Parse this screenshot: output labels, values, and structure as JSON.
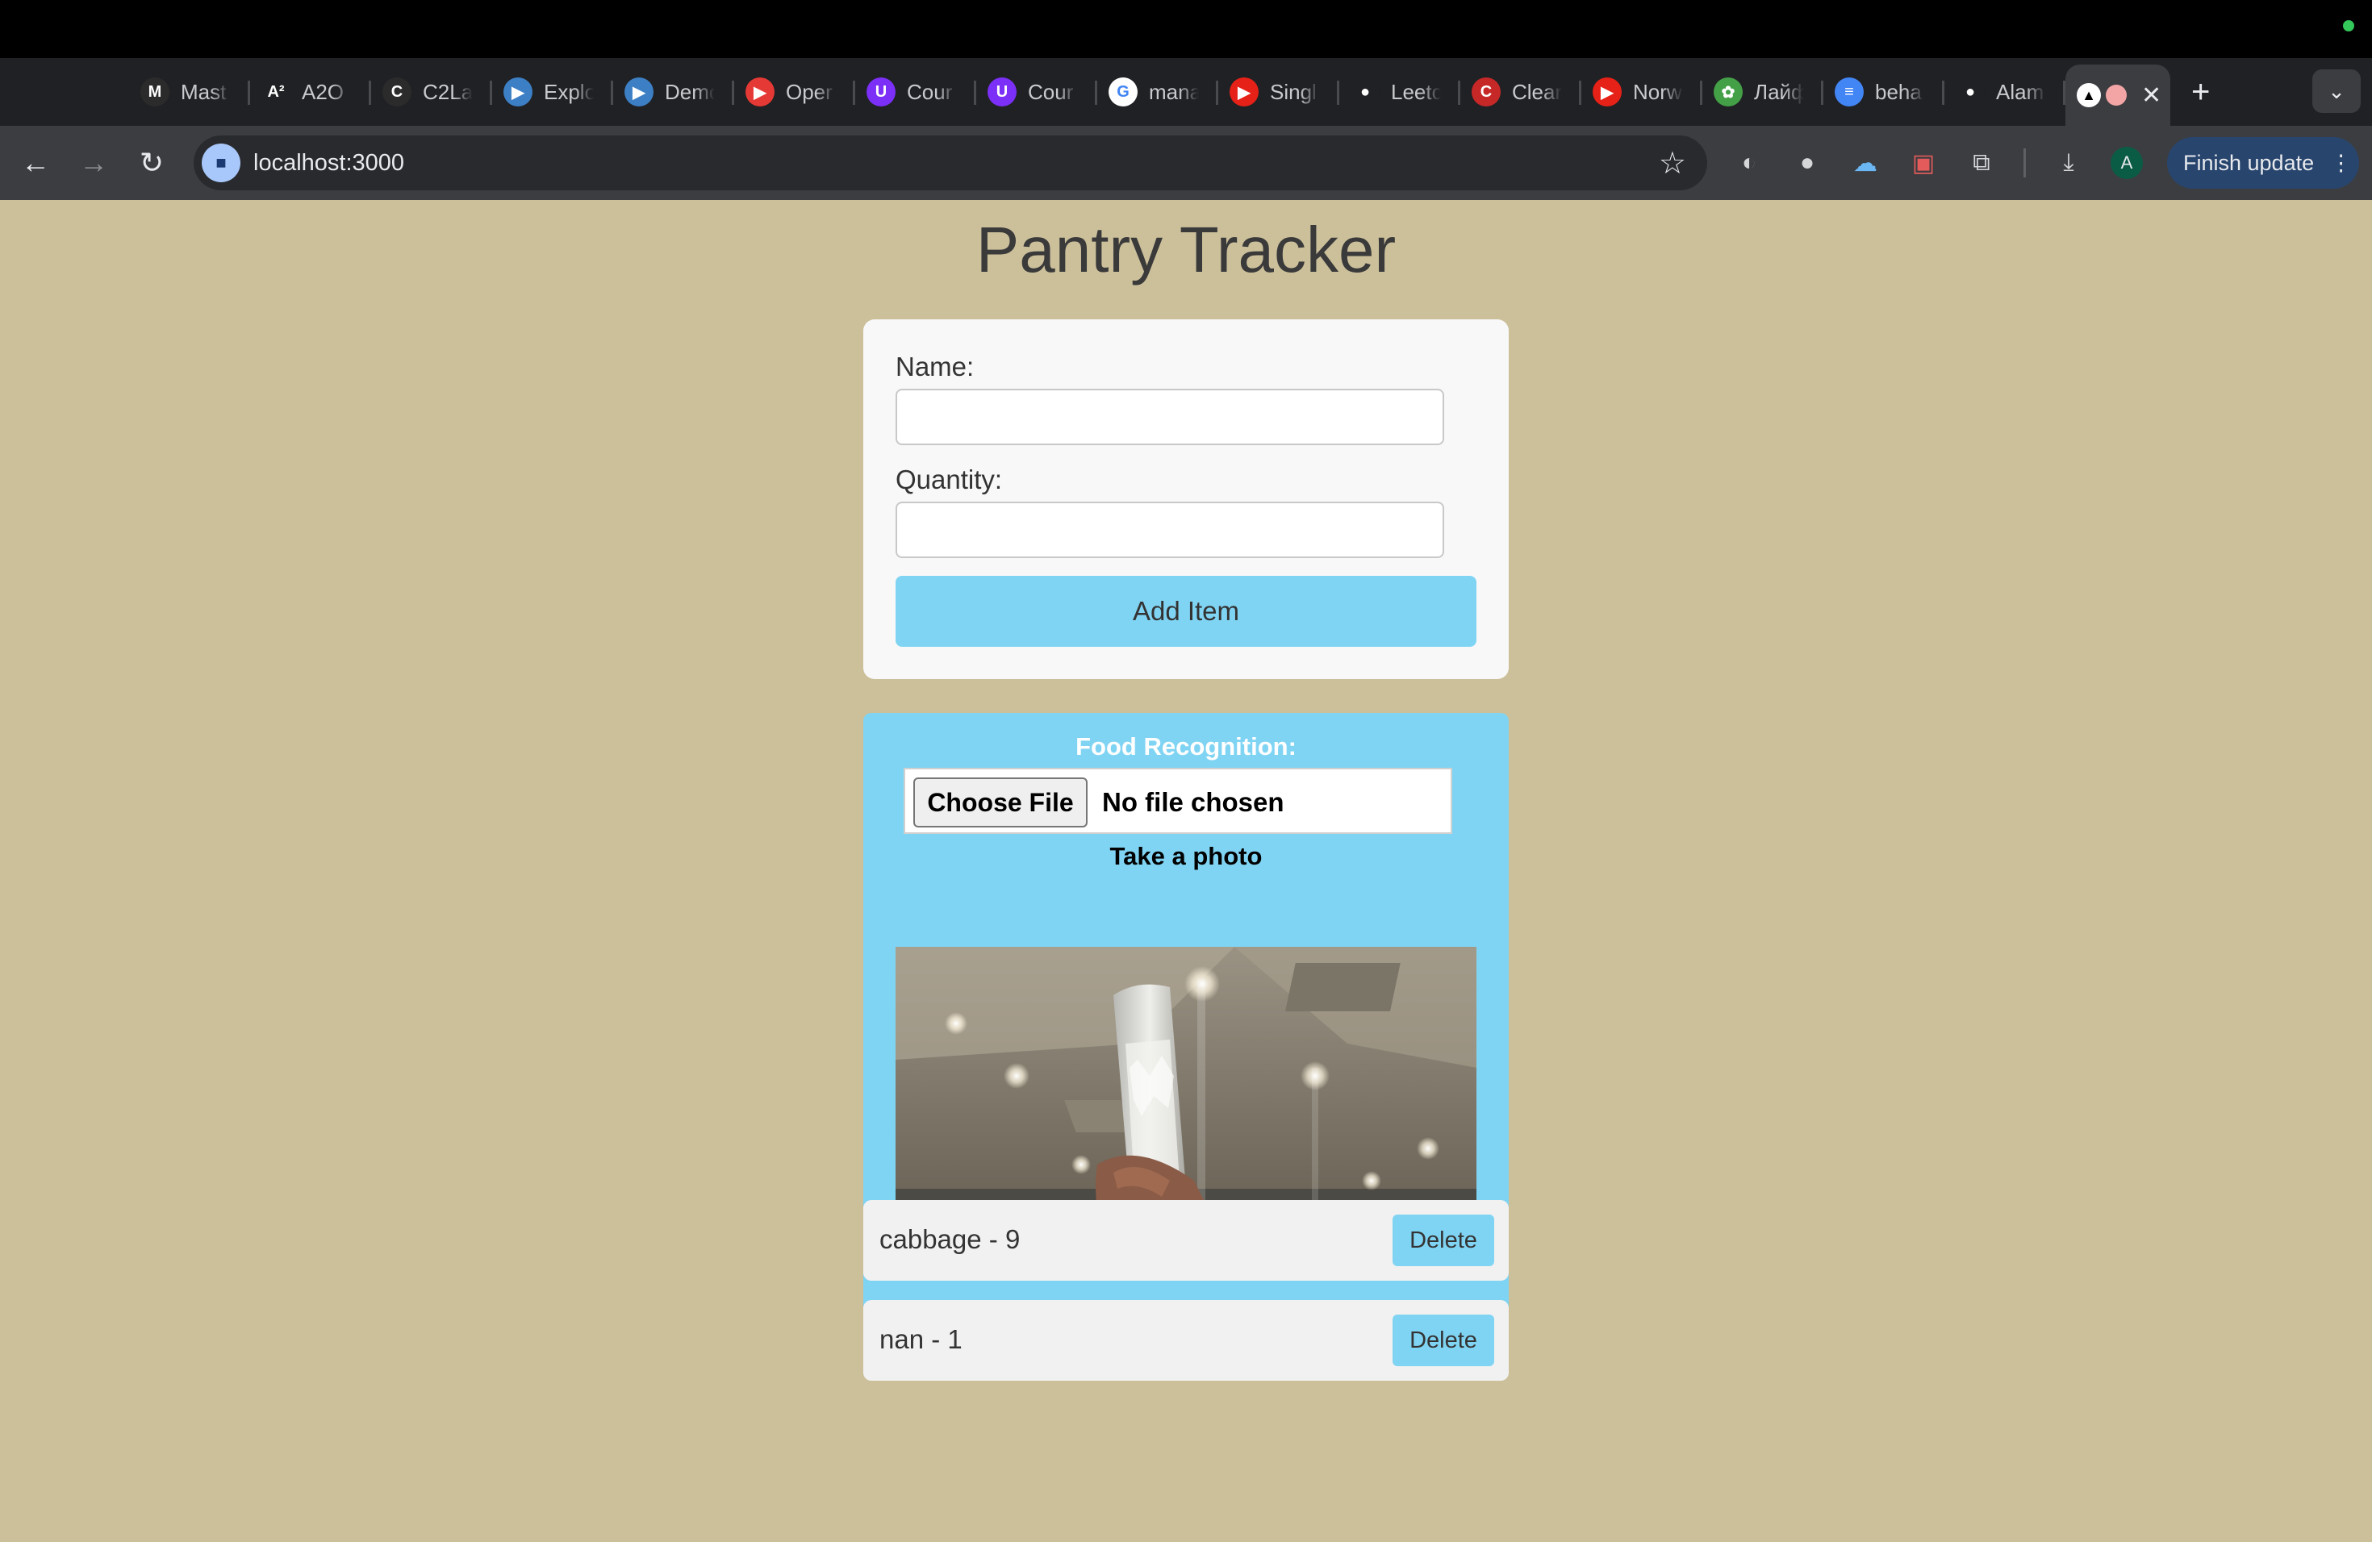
{
  "browser": {
    "tabs": [
      {
        "label": "Mast",
        "icon": "m-logo-icon",
        "color": "#2b2b2b",
        "glyph": "M"
      },
      {
        "label": "A2O",
        "icon": "a2-logo-icon",
        "color": "#202124",
        "glyph": "A²"
      },
      {
        "label": "C2La",
        "icon": "c2la-logo-icon",
        "color": "#2b2b2b",
        "glyph": "C"
      },
      {
        "label": "Explo",
        "icon": "video-play-icon",
        "color": "#3d7fc4",
        "glyph": "▶"
      },
      {
        "label": "Demo",
        "icon": "video-play-icon",
        "color": "#3d7fc4",
        "glyph": "▶"
      },
      {
        "label": "Oper",
        "icon": "play-record-icon",
        "color": "#e53935",
        "glyph": "▶"
      },
      {
        "label": "Cour",
        "icon": "u-logo-icon",
        "color": "#7b2ff7",
        "glyph": "U"
      },
      {
        "label": "Cour",
        "icon": "u-logo-icon",
        "color": "#7b2ff7",
        "glyph": "U"
      },
      {
        "label": "mana",
        "icon": "google-icon",
        "color": "#ffffff",
        "glyph": "G"
      },
      {
        "label": "Singl",
        "icon": "youtube-icon",
        "color": "#e62117",
        "glyph": "▶"
      },
      {
        "label": "Leetc",
        "icon": "github-icon",
        "color": "#202124",
        "glyph": "●"
      },
      {
        "label": "Clear",
        "icon": "clear-logo-icon",
        "color": "#c62828",
        "glyph": "C"
      },
      {
        "label": "Norw",
        "icon": "youtube-icon",
        "color": "#e62117",
        "glyph": "▶"
      },
      {
        "label": "Лайф",
        "icon": "flower-icon",
        "color": "#43a047",
        "glyph": "✿"
      },
      {
        "label": "beha",
        "icon": "docs-icon",
        "color": "#4285f4",
        "glyph": "≡"
      },
      {
        "label": "Alam",
        "icon": "github-icon",
        "color": "#202124",
        "glyph": "●"
      }
    ],
    "active_tab_close": "✕",
    "new_tab": "+",
    "url": "localhost:3000",
    "finish_update": "Finish update",
    "avatar_letter": "A"
  },
  "page": {
    "title": "Pantry Tracker",
    "form": {
      "name_label": "Name:",
      "name_value": "",
      "quantity_label": "Quantity:",
      "quantity_value": "",
      "add_button": "Add Item"
    },
    "food": {
      "title": "Food Recognition:",
      "choose_file": "Choose File",
      "no_file": "No file chosen",
      "take_photo": "Take a photo"
    },
    "items": [
      {
        "text": "cabbage - 9",
        "delete": "Delete"
      },
      {
        "text": "nan - 1",
        "delete": "Delete"
      }
    ]
  },
  "colors": {
    "background": "#ccc09b",
    "accent": "#80d4f3",
    "card": "#f8f8f8"
  }
}
